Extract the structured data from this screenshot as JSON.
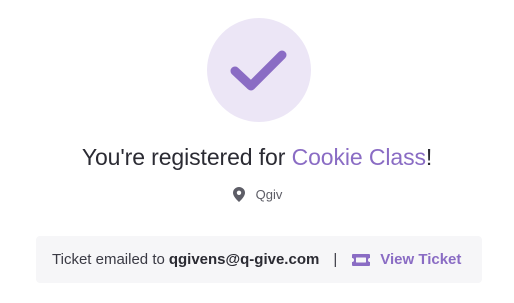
{
  "confirmation": {
    "title_prefix": "You're registered for ",
    "event_name": "Cookie Class",
    "title_suffix": "!"
  },
  "location": {
    "icon": "map-pin-icon",
    "name": "Qgiv"
  },
  "ticket": {
    "emailed_label": "Ticket emailed to",
    "email": "qgivens@q-give.com",
    "separator": "|",
    "view_label": "View Ticket",
    "view_icon": "ticket-icon"
  },
  "colors": {
    "accent": "#8a6cc4",
    "check_bg": "#ece6f6",
    "banner_bg": "#f6f6f8"
  }
}
